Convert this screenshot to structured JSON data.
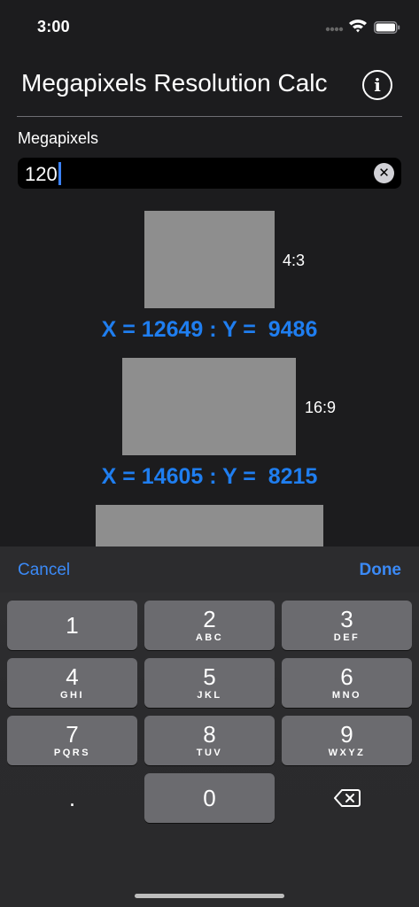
{
  "status_bar": {
    "time": "3:00"
  },
  "header": {
    "title": "Megapixels Resolution Calc"
  },
  "input": {
    "label": "Megapixels",
    "value": "120"
  },
  "results": [
    {
      "ratio": "4:3",
      "resolution": "X = 12649 : Y =  9486"
    },
    {
      "ratio": "16:9",
      "resolution": "X = 14605 : Y =  8215"
    }
  ],
  "keyboard": {
    "cancel": "Cancel",
    "done": "Done",
    "keys": [
      {
        "digit": "1",
        "letters": ""
      },
      {
        "digit": "2",
        "letters": "ABC"
      },
      {
        "digit": "3",
        "letters": "DEF"
      },
      {
        "digit": "4",
        "letters": "GHI"
      },
      {
        "digit": "5",
        "letters": "JKL"
      },
      {
        "digit": "6",
        "letters": "MNO"
      },
      {
        "digit": "7",
        "letters": "PQRS"
      },
      {
        "digit": "8",
        "letters": "TUV"
      },
      {
        "digit": "9",
        "letters": "WXYZ"
      },
      {
        "digit": ".",
        "letters": ""
      },
      {
        "digit": "0",
        "letters": ""
      }
    ]
  },
  "colors": {
    "accent": "#1f7ef0",
    "background": "#1c1c1e",
    "key": "#6b6b6f"
  }
}
